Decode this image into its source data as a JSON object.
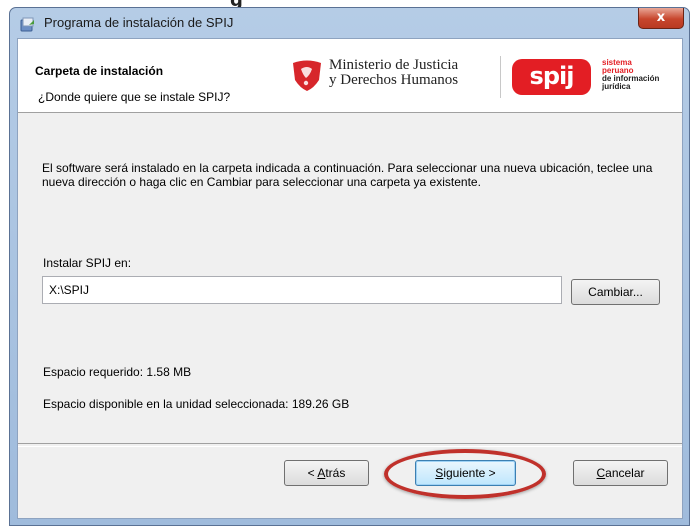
{
  "window": {
    "title": "Programa de instalación de SPIJ",
    "close_label": "x"
  },
  "header": {
    "title": "Carpeta de instalación",
    "subtitle": "¿Donde quiere que se instale SPIJ?",
    "ministry_logo": {
      "line1": "Ministerio de Justicia",
      "line2": "y Derechos Humanos"
    },
    "spij_logo": {
      "badge": "spij",
      "tagline1": "sistema",
      "tagline2": "peruano",
      "tagline3": "de información",
      "tagline4": "jurídica"
    }
  },
  "body": {
    "description": "El software será instalado en la carpeta indicada a continuación. Para seleccionar una nueva ubicación, teclee una nueva dirección o haga clic en Cambiar para seleccionar una carpeta ya existente.",
    "install_label": "Instalar SPIJ en:",
    "install_path": "X:\\SPIJ",
    "change_button": "Cambiar...",
    "space_required": "Espacio requerido: 1.58 MB",
    "space_available": "Espacio disponible en la unidad seleccionada: 189.26 GB"
  },
  "buttons": {
    "back_prefix": "< ",
    "back_underlined": "A",
    "back_rest": "trás",
    "next_underlined": "S",
    "next_rest": "iguiente >",
    "cancel_underlined": "C",
    "cancel_rest": "ancelar"
  },
  "colors": {
    "spij_red": "#e31e24",
    "annotation_red": "#c0312b",
    "title_bar": "#b5cce6"
  }
}
